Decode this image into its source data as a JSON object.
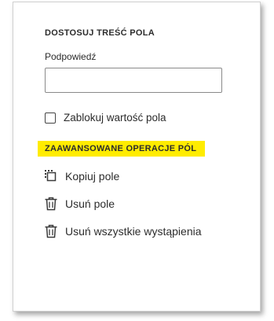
{
  "section": {
    "title": "DOSTOSUJ TREŚĆ POLA"
  },
  "hint": {
    "label": "Podpowiedź",
    "value": ""
  },
  "lock": {
    "label": "Zablokuj wartość pola",
    "checked": false
  },
  "advanced": {
    "title": "ZAAWANSOWANE OPERACJE PÓL",
    "highlight_color": "#ffec00",
    "actions": [
      {
        "label": "Kopiuj pole",
        "icon": "copy-icon"
      },
      {
        "label": "Usuń pole",
        "icon": "trash-icon"
      },
      {
        "label": "Usuń wszystkie wystąpienia",
        "icon": "trash-icon"
      }
    ]
  }
}
